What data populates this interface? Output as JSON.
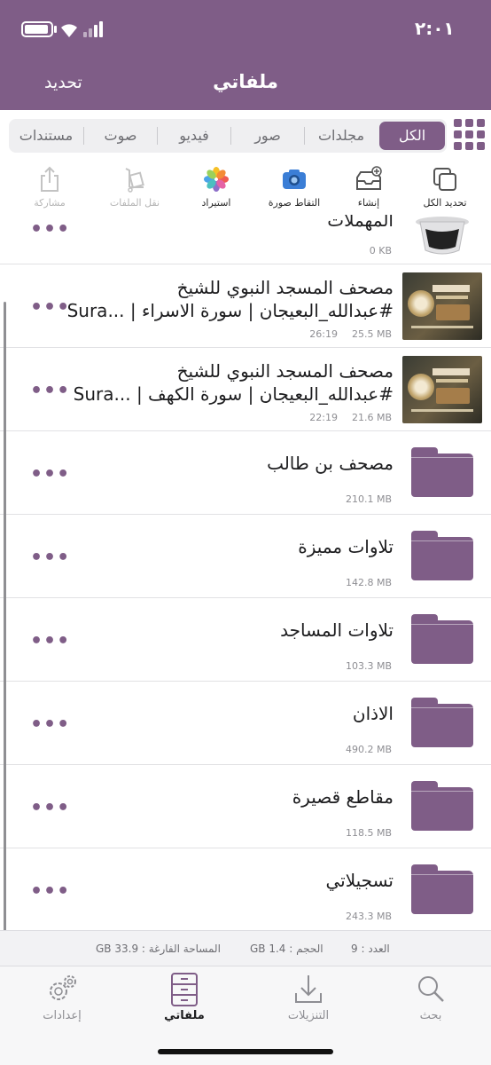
{
  "status_bar": {
    "time": "٢:٠١"
  },
  "header": {
    "title": "ملفاتي",
    "refresh_label": "تحديد"
  },
  "tabs": [
    {
      "label": "الكل",
      "active": true
    },
    {
      "label": "مجلدات",
      "active": false
    },
    {
      "label": "صور",
      "active": false
    },
    {
      "label": "فيديو",
      "active": false
    },
    {
      "label": "صوت",
      "active": false
    },
    {
      "label": "مستندات",
      "active": false
    }
  ],
  "toolbar": {
    "select_all": "تحديد الكل",
    "create": "إنشاء",
    "take_photo": "التقاط صورة",
    "import": "استيراد",
    "move_files": "نقل الملفات",
    "share": "مشاركة"
  },
  "files": [
    {
      "kind": "trash",
      "title": "المهملات",
      "size": "0 KB",
      "duration": ""
    },
    {
      "kind": "video",
      "title_line1": "مصحف المسجد النبوي للشيخ",
      "title_line2": "#عبدالله_البعيجان | سورة الاسراء | ...Sura",
      "size": "25.5 MB",
      "duration": "26:19"
    },
    {
      "kind": "video",
      "title_line1": "مصحف المسجد النبوي للشيخ",
      "title_line2": "#عبدالله_البعيجان | سورة الكهف | ...Sura",
      "size": "21.6 MB",
      "duration": "22:19"
    },
    {
      "kind": "folder",
      "title": "مصحف بن طالب",
      "size": "210.1 MB"
    },
    {
      "kind": "folder",
      "title": "تلاوات مميزة",
      "size": "142.8 MB"
    },
    {
      "kind": "folder",
      "title": "تلاوات المساجد",
      "size": "103.3 MB"
    },
    {
      "kind": "folder",
      "title": "الاذان",
      "size": "490.2 MB"
    },
    {
      "kind": "folder",
      "title": "مقاطع قصيرة",
      "size": "118.5 MB"
    },
    {
      "kind": "folder",
      "title": "تسجيلاتي",
      "size": "243.3 MB"
    }
  ],
  "more_symbol": "•••",
  "summary": {
    "count": "العدد : 9",
    "size": "الحجم : 1.4 GB",
    "free_space": "المساحة الفارغة : 33.9 GB"
  },
  "bottom_tabs": [
    {
      "label": "بحث",
      "icon": "search-icon"
    },
    {
      "label": "التنزيلات",
      "icon": "download-icon"
    },
    {
      "label": "ملفاتي",
      "icon": "cabinet-icon",
      "active": true
    },
    {
      "label": "إعدادات",
      "icon": "gear-icon"
    }
  ],
  "colors": {
    "accent": "#7f5d87",
    "header_bg": "#7f5d87"
  }
}
